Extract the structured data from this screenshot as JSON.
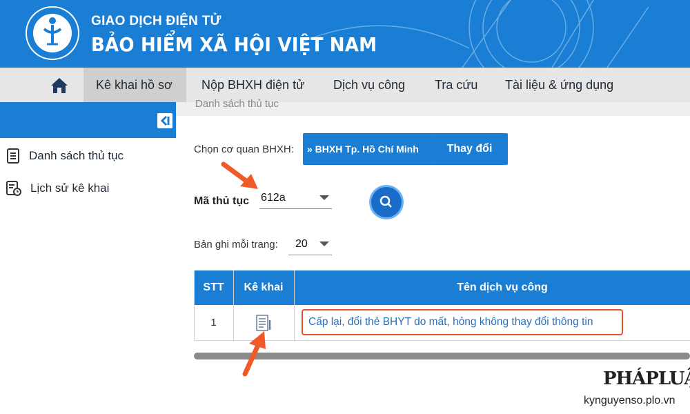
{
  "header": {
    "line1": "GIAO DỊCH ĐIỆN TỬ",
    "line2": "BẢO HIỂM XÃ HỘI VIỆT NAM",
    "logo_text": "BẢO HIỂM XÃ HỘI VIỆT NAM"
  },
  "nav": {
    "items": [
      {
        "label": "Kê khai hồ sơ"
      },
      {
        "label": "Nộp BHXH điện tử"
      },
      {
        "label": "Dịch vụ công"
      },
      {
        "label": "Tra cứu"
      },
      {
        "label": "Tài liệu & ứng dụng"
      }
    ]
  },
  "sidebar": {
    "items": [
      {
        "label": "Danh sách thủ tục"
      },
      {
        "label": "Lịch sử kê khai"
      }
    ]
  },
  "main": {
    "band_text": "Danh sách thủ tục",
    "agency_label": "Chọn cơ quan BHXH:",
    "agency_value": "» BHXH Tp. Hồ Chí Minh",
    "change_label": "Thay đổi",
    "code_label": "Mã thủ tục",
    "code_value": "612a",
    "per_page_label": "Bản ghi mỗi trang:",
    "per_page_value": "20"
  },
  "table": {
    "headers": [
      "STT",
      "Kê khai",
      "Tên dịch vụ công"
    ],
    "rows": [
      {
        "stt": "1",
        "name": "Cấp lại, đổi thẻ BHYT do mất, hỏng không thay đổi thông tin"
      }
    ]
  },
  "watermark": {
    "brand": "PHÁPLUẬT",
    "url": "kynguyenso.plo.vn"
  },
  "colors": {
    "primary": "#1a7fd4",
    "highlight": "#e8502a"
  }
}
